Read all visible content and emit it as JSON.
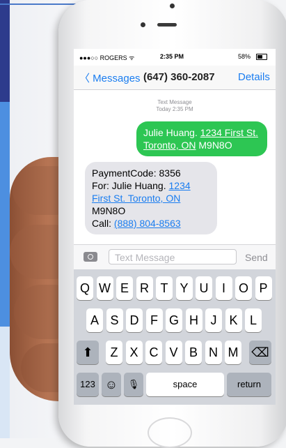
{
  "status_bar": {
    "carrier": "●●●○○ ROGERS ᯤ",
    "time": "2:35 PM",
    "battery": "58%"
  },
  "nav": {
    "back_label": "〈 Messages",
    "title": "(647) 360-2087",
    "details_label": "Details"
  },
  "meta": {
    "line1": "Text Message",
    "line2": "Today 2:35 PM"
  },
  "sent_message": {
    "name": "Julie Huang.",
    "link": "1234 First St. Toronto, ON",
    "tail": "M9N8O"
  },
  "received_message": {
    "line1": "PaymentCode: 8356",
    "for_prefix": "For: Julie Huang.",
    "for_link": "1234 First St. Toronto, ON",
    "postal": "M9N8O",
    "call_prefix": "Call:",
    "call_link": "(888) 804-8563"
  },
  "input": {
    "placeholder": "Text Message",
    "send_label": "Send"
  },
  "keyboard": {
    "row1": [
      "Q",
      "W",
      "E",
      "R",
      "T",
      "Y",
      "U",
      "I",
      "O",
      "P"
    ],
    "row2": [
      "A",
      "S",
      "D",
      "F",
      "G",
      "H",
      "J",
      "K",
      "L"
    ],
    "row3": [
      "Z",
      "X",
      "C",
      "V",
      "B",
      "N",
      "M"
    ],
    "numbers_label": "123",
    "space_label": "space",
    "return_label": "return"
  },
  "icons": {
    "camera": "camera-icon",
    "emoji": "emoji-icon",
    "mic": "microphone-icon",
    "shift": "shift-icon",
    "delete": "delete-icon"
  }
}
